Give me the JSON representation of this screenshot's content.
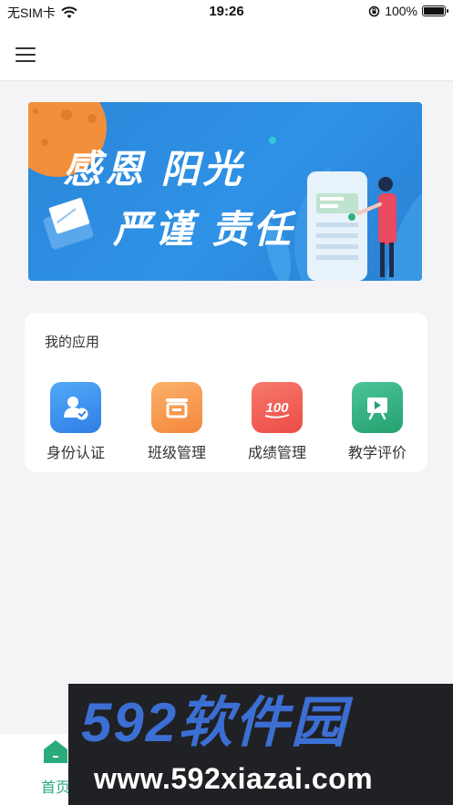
{
  "status_bar": {
    "carrier": "无SIM卡",
    "time": "19:26",
    "battery": "100%"
  },
  "banner": {
    "line1": "感恩  阳光",
    "line2": "严谨  责任"
  },
  "apps": {
    "title": "我的应用",
    "items": [
      {
        "label": "身份认证",
        "icon": "id-check-icon",
        "color": "#3d8ff0"
      },
      {
        "label": "班级管理",
        "icon": "class-icon",
        "color": "#f6964a"
      },
      {
        "label": "成绩管理",
        "icon": "score-100-icon",
        "color": "#f0584f"
      },
      {
        "label": "教学评价",
        "icon": "teaching-board-icon",
        "color": "#2fb07d"
      }
    ]
  },
  "tab_bar": {
    "home_label": "首页",
    "active_color": "#2bab7c"
  },
  "watermark": {
    "logo": "592软件园",
    "url": "www.592xiazai.com"
  }
}
